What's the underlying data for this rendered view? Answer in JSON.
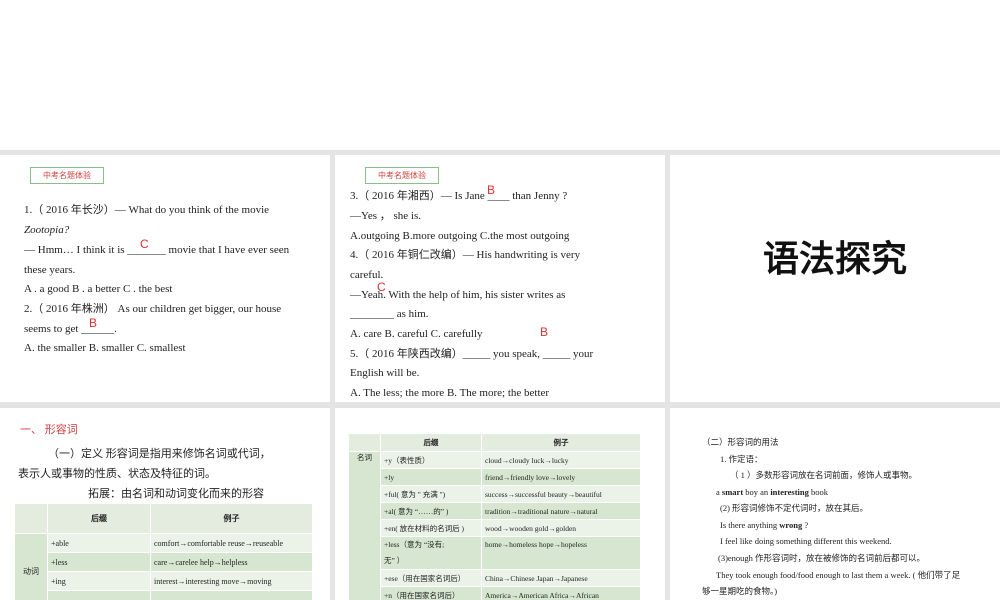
{
  "slide1": {
    "tag": "中考名题体验",
    "lines": [
      "1.（ 2016 年长沙）—   What do you think of the movie",
      "Zootopia?",
      "— Hmm… I think it is _______ movie that I have ever seen",
      "these years.",
      "A .   a good    B .   a better   C .   the best",
      "2.（ 2016 年株洲） As our children get bigger, our house",
      "seems to get ______.",
      "A. the smaller  B. smaller       C. smallest"
    ],
    "answers": [
      "C",
      "B"
    ]
  },
  "slide2": {
    "tag": "中考名题体验",
    "lines": [
      "3.（ 2016 年湘西）— Is Jane ____  than Jenny ?",
      "—Yes ，  she is.",
      "A.outgoing        B.more outgoing       C.the most outgoing",
      "4.（ 2016 年铜仁改编）— His handwriting is very",
      "careful.",
      "    —Yeah. With the help of him, his sister writes as",
      "________ as him.",
      "   A. care        B. careful       C. carefully",
      "5.（ 2016 年陕西改编）_____ you speak,  _____  your",
      "English will be.",
      "      A. The less; the more      B. The more; the better"
    ],
    "answers": [
      "B",
      "C",
      "B"
    ]
  },
  "slide3": {
    "title": "语法探究"
  },
  "slide4": {
    "heading": "一、  形容词",
    "def1": "（一）定义     形容词是指用来修饰名词或代词，",
    "def2": "表示人或事物的性质、状态及特征的词。",
    "ext": "拓展：由名词和动词变化而来的形容",
    "headers": [
      "",
      "后缀",
      "例子"
    ],
    "category": "动词",
    "rows": [
      [
        "+able",
        "comfort→comfortable   reuse→reuseable"
      ],
      [
        "+less",
        "care→carelee              help→helpless"
      ],
      [
        "+ing",
        "interest→interesting    move→moving"
      ],
      [
        "",
        ""
      ]
    ]
  },
  "slide5": {
    "headers": [
      "",
      "后缀",
      "例子"
    ],
    "category": "名词",
    "rows": [
      [
        "+y（表性质）",
        "cloud→cloudy     luck→lucky"
      ],
      [
        "+ly",
        "friend→friendly   love→lovely"
      ],
      [
        "+ful( 意为 \" 充满 \")",
        "success→successful    beauty→beautiful"
      ],
      [
        "+al( 意为 “……的” )",
        "tradition→traditional      nature→natural"
      ],
      [
        "+en( 放在材料的名词后 )",
        "wood→wooden      gold→golden"
      ],
      [
        "+less（意为 “没有;\n无” ）",
        "home→homeless       hope→hopeless"
      ],
      [
        "+ese（用在国家名词后）",
        "China→Chinese              Japan→Japanese"
      ],
      [
        "+n（用在国家名词后）",
        "America→American       Africa→African"
      ]
    ]
  },
  "slide6": {
    "lines": [
      "（二）形容词的用法",
      "1. 作定语：",
      "（ 1 ）多数形容词放在名词前面，修饰人或事物。",
      "(2) 形容词修饰不定代词时，放在其后。",
      "I feel like doing something different this weekend.",
      "(3)enough  作形容词时，放在被修饰的名词前后都可以。",
      "They took enough food/food enough to last them a week. ( 他们带了足",
      "够一星期吃的食物。)"
    ],
    "ex1": {
      "a": "a ",
      "smart": "smart",
      "boy": " boy    an ",
      "interesting": "interesting",
      "book": " book"
    },
    "ex2": {
      "pre": "Is there anything ",
      "wrong": "wrong",
      "post": " ?"
    }
  }
}
